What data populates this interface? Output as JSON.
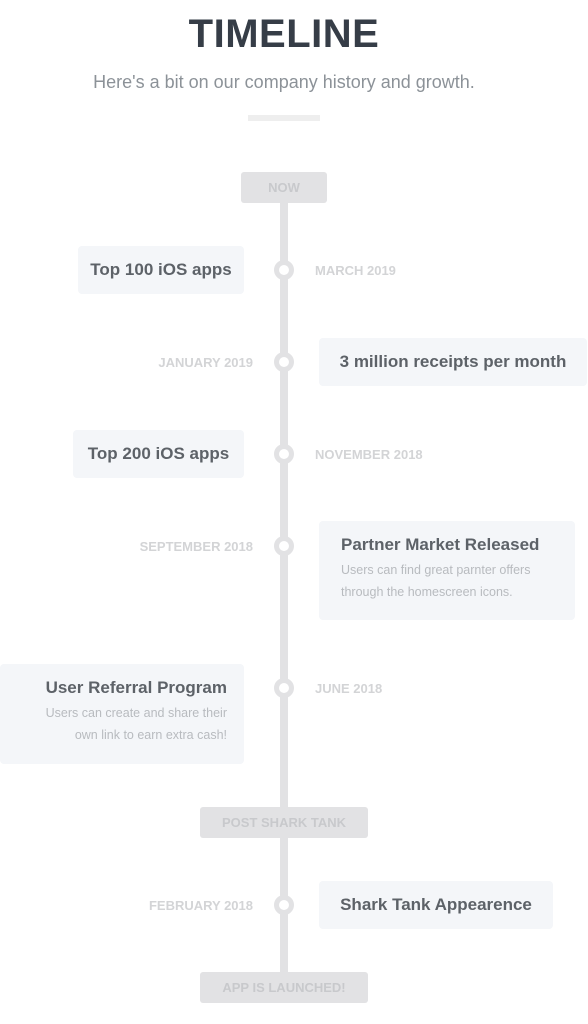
{
  "header": {
    "title": "TIMELINE",
    "subtitle": "Here's a bit on our company history and growth."
  },
  "markers": {
    "now": "NOW",
    "post_shark_tank": "POST SHARK TANK",
    "launched": "APP IS LAUNCHED!"
  },
  "events": [
    {
      "date": "MARCH 2019",
      "title": "Top 100 iOS apps",
      "side": "left"
    },
    {
      "date": "JANUARY 2019",
      "title": "3 million receipts per month",
      "side": "right"
    },
    {
      "date": "NOVEMBER 2018",
      "title": "Top 200 iOS apps",
      "side": "left"
    },
    {
      "date": "SEPTEMBER 2018",
      "title": "Partner Market Released",
      "description": "Users can find great parnter offers through the homescreen icons.",
      "side": "right"
    },
    {
      "date": "JUNE 2018",
      "title": "User Referral Program",
      "description": "Users can create and share their own link to earn extra cash!",
      "side": "left"
    },
    {
      "date": "FEBRUARY 2018",
      "title": "Shark Tank Appearence",
      "side": "right"
    }
  ],
  "colors": {
    "title": "#363d47",
    "line": "#e2e2e4",
    "card_bg": "#f4f6f9",
    "date_text": "#d3d4d6"
  }
}
